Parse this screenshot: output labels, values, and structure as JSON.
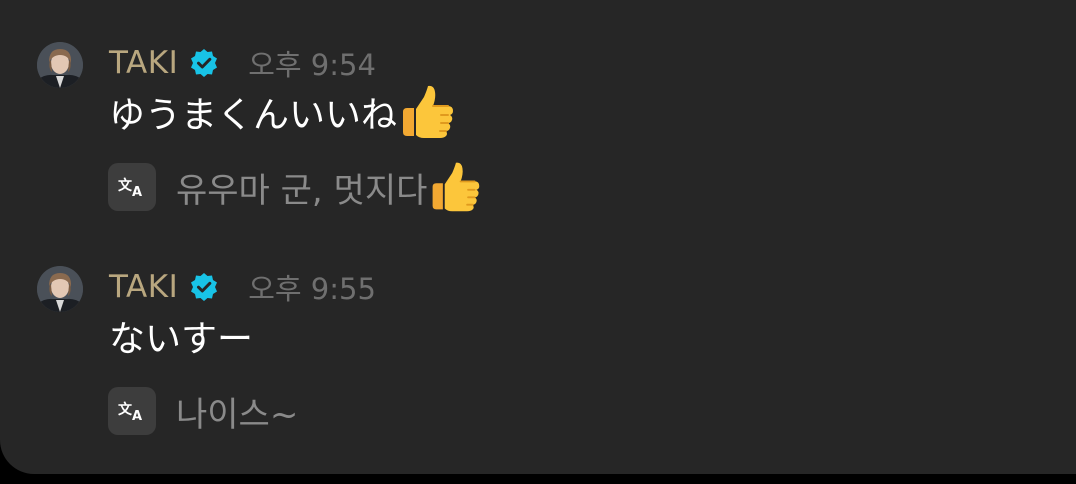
{
  "colors": {
    "background": "#262626",
    "username": "#b9a77f",
    "verified_badge": "#18c3e6",
    "timestamp": "#6f6f6f",
    "message_text": "#ffffff",
    "translation_text": "#8a8a8a"
  },
  "messages": [
    {
      "username": "TAKI",
      "verified": true,
      "time": "오후 9:54",
      "text": "ゆうまくんいいね",
      "text_emoji": "thumbs-up",
      "translation_icon": "translate-icon",
      "translation": "유우마 군, 멋지다",
      "translation_emoji": "thumbs-up"
    },
    {
      "username": "TAKI",
      "verified": true,
      "time": "오후 9:55",
      "text": "ないすー",
      "translation_icon": "translate-icon",
      "translation": "나이스~"
    }
  ]
}
